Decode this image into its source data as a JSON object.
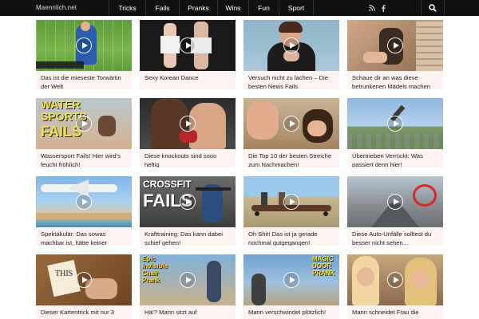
{
  "header": {
    "logo": "Maennlich.net",
    "nav": [
      {
        "label": "Tricks",
        "name": "nav-tricks"
      },
      {
        "label": "Fails",
        "name": "nav-fails"
      },
      {
        "label": "Pranks",
        "name": "nav-pranks"
      },
      {
        "label": "Wins",
        "name": "nav-wins"
      },
      {
        "label": "Fun",
        "name": "nav-fun"
      },
      {
        "label": "Sport",
        "name": "nav-sport"
      }
    ],
    "icons": [
      "rss-icon",
      "facebook-icon",
      "search-icon"
    ]
  },
  "thumb_overlays": {
    "water": [
      "WATER",
      "SPORTS",
      "FAILS"
    ],
    "crossfit": [
      "CROSSFIT",
      "FAILS"
    ],
    "chair": [
      "Epic",
      "Invisible",
      "Chair",
      "Prank"
    ],
    "door": [
      "MAGIC",
      "DOOR",
      "PRANK"
    ],
    "this": "THIS"
  },
  "videos": [
    {
      "title": "Das ist die mieseste Torwärtin der Welt",
      "thumb": "goal"
    },
    {
      "title": "Sexy Korean Dance",
      "thumb": "dance"
    },
    {
      "title": "Versuch nicht zu lachen – Die besten News Fails",
      "thumb": "news"
    },
    {
      "title": "Schaue dir an was diese betrunkenen Mädels machen",
      "thumb": "drunk"
    },
    {
      "title": "Wassersport Fails! Hier wird's feucht fröhlich!",
      "thumb": "water"
    },
    {
      "title": "Diese knockouts sind sooo heftig",
      "thumb": "boxing"
    },
    {
      "title": "Die Top 10 der besten Streiche zum Nachmachen!",
      "thumb": "prank"
    },
    {
      "title": "Übertrieben Verrückt: Was passiert denn hier!",
      "thumb": "sky"
    },
    {
      "title": "Spektakulär: Das sowas machbar ist, hätte keiner erwartet!",
      "thumb": "plane"
    },
    {
      "title": "Krafttraining: Das kann dabei schief gehen!",
      "thumb": "crossfit"
    },
    {
      "title": "Oh Shit! Das ist ja gerade nochmal gutgegangen!",
      "thumb": "skate"
    },
    {
      "title": "Diese Auto-Unfälle solltest du besser nicht sehen…",
      "thumb": "road"
    },
    {
      "title": "Dieser Kartentrick mit nur 3",
      "thumb": "card"
    },
    {
      "title": "Hä!? Mann sitzt auf",
      "thumb": "chair"
    },
    {
      "title": "Mann verschwindet plötzlich!",
      "thumb": "door"
    },
    {
      "title": "Mann schneidet Frau die",
      "thumb": "hair"
    }
  ],
  "colors": {
    "topbar": "#111111",
    "card_bg": "#fdf3f0",
    "text": "#222222"
  }
}
